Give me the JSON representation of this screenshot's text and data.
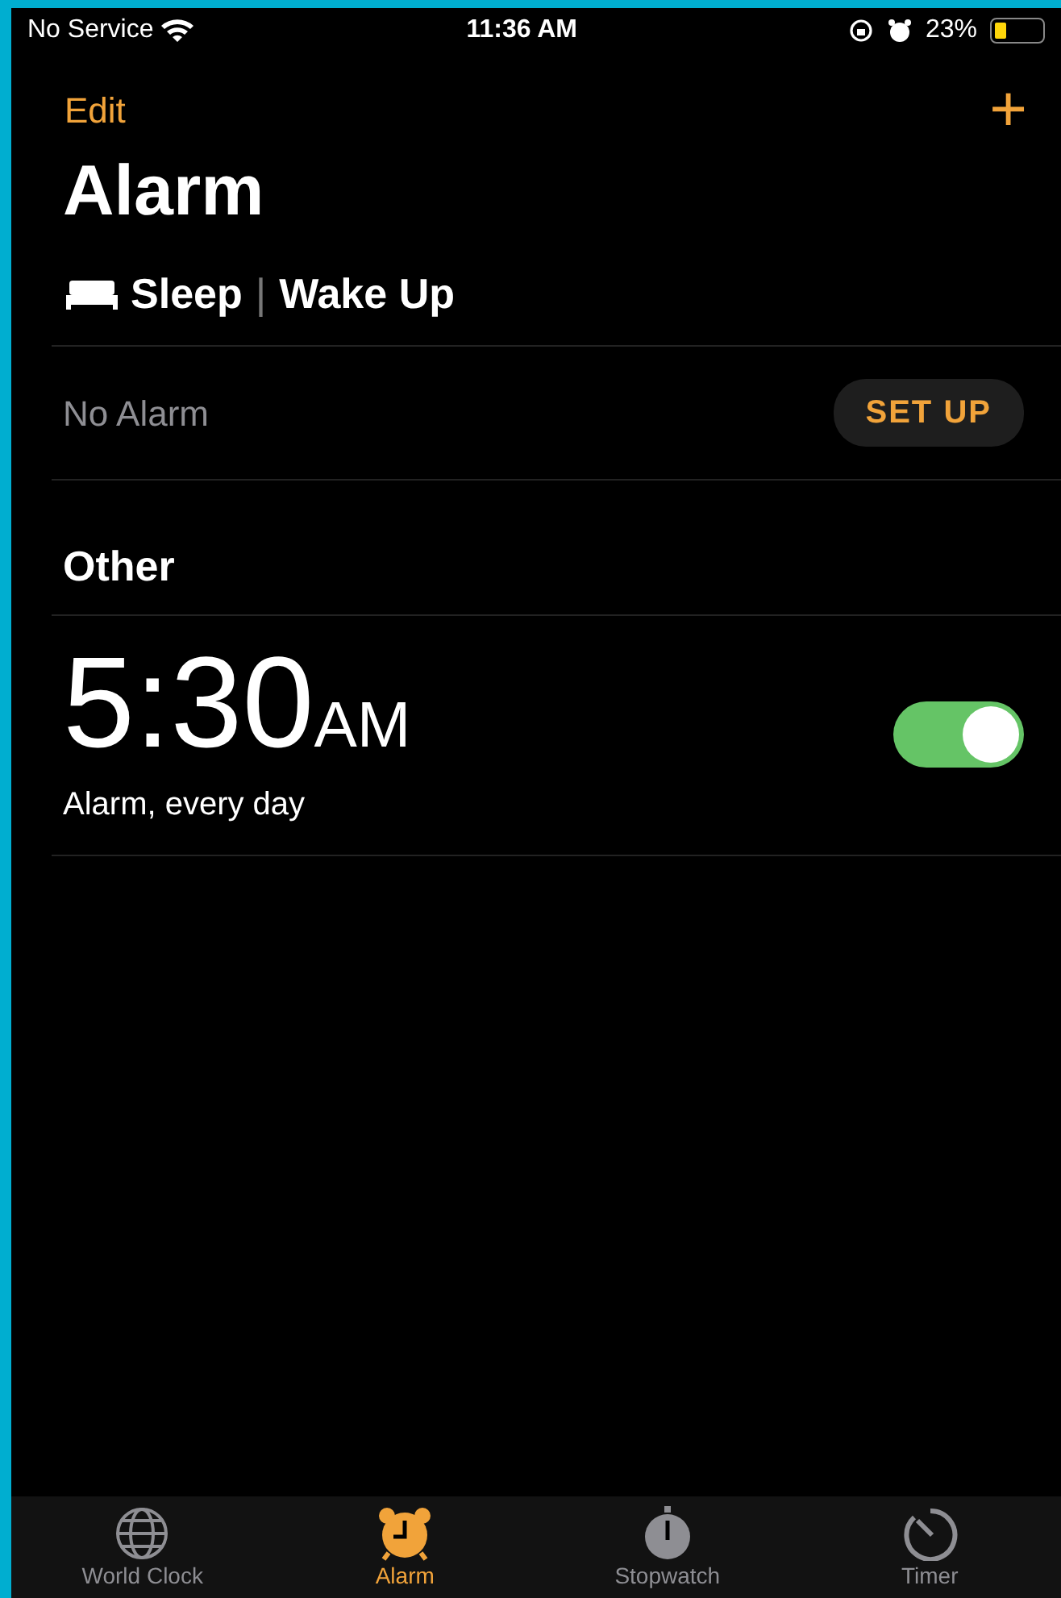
{
  "status_bar": {
    "carrier": "No Service",
    "time": "11:36 AM",
    "battery": "23%"
  },
  "nav": {
    "edit": "Edit",
    "add": "+"
  },
  "title": "Alarm",
  "sleep_section": {
    "sleep": "Sleep",
    "separator": "|",
    "wake": "Wake Up",
    "status": "No Alarm",
    "button": "SET UP"
  },
  "other_section": {
    "heading": "Other",
    "alarms": [
      {
        "time": "5:30",
        "period": "AM",
        "label": "Alarm, every day",
        "on": true
      }
    ]
  },
  "tabs": [
    {
      "label": "World Clock",
      "kind": "globe",
      "selected": false
    },
    {
      "label": "Alarm",
      "kind": "alarm",
      "selected": true
    },
    {
      "label": "Stopwatch",
      "kind": "stopwatch",
      "selected": false
    },
    {
      "label": "Timer",
      "kind": "timer",
      "selected": false
    }
  ]
}
